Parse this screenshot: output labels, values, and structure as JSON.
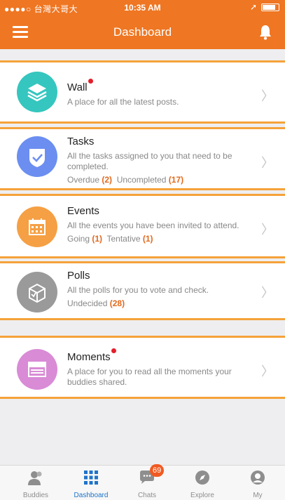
{
  "status_bar": {
    "carrier": "●●●●○ 台灣大哥大",
    "time": "10:35 AM",
    "location_glyph": "➚"
  },
  "header": {
    "title": "Dashboard",
    "menu_icon": "menu-icon",
    "bell_icon": "bell-icon"
  },
  "colors": {
    "header": "#ef7622",
    "highlight_border": "#f5a23a",
    "accent_number": "#e26a1e",
    "active_tab": "#1f73c9"
  },
  "cards": [
    {
      "name": "Wall",
      "has_dot": true,
      "desc": "A place for all the latest posts.",
      "icon": "layers-icon",
      "icon_color": "#35c6bf"
    },
    {
      "name": "Tasks",
      "has_dot": false,
      "desc": "All the tasks assigned to you that need to be completed.",
      "meta_a_label": "Overdue",
      "meta_a_value": "(2)",
      "meta_b_label": "Uncompleted",
      "meta_b_value": "(17)",
      "icon": "shield-check-icon",
      "icon_color": "#6b8ef0"
    },
    {
      "name": "Events",
      "has_dot": false,
      "desc": "All the events you have been invited to attend.",
      "meta_a_label": "Going",
      "meta_a_value": "(1)",
      "meta_b_label": "Tentative",
      "meta_b_value": "(1)",
      "icon": "calendar-icon",
      "icon_color": "#f5a044"
    },
    {
      "name": "Polls",
      "has_dot": false,
      "desc": "All the polls for you to vote and check.",
      "meta_a_label": "Undecided",
      "meta_a_value": "(28)",
      "icon": "ballot-box-icon",
      "icon_color": "#9a9a9a"
    },
    {
      "name": "Moments",
      "has_dot": true,
      "desc": "A place for you to read all the moments your buddies shared.",
      "icon": "moments-icon",
      "icon_color": "#d98bd6"
    }
  ],
  "tabs": [
    {
      "label": "Buddies",
      "icon": "buddies-icon"
    },
    {
      "label": "Dashboard",
      "icon": "dashboard-grid-icon",
      "active": true
    },
    {
      "label": "Chats",
      "icon": "chat-icon",
      "badge": "69"
    },
    {
      "label": "Explore",
      "icon": "compass-icon"
    },
    {
      "label": "My",
      "icon": "profile-icon"
    }
  ]
}
